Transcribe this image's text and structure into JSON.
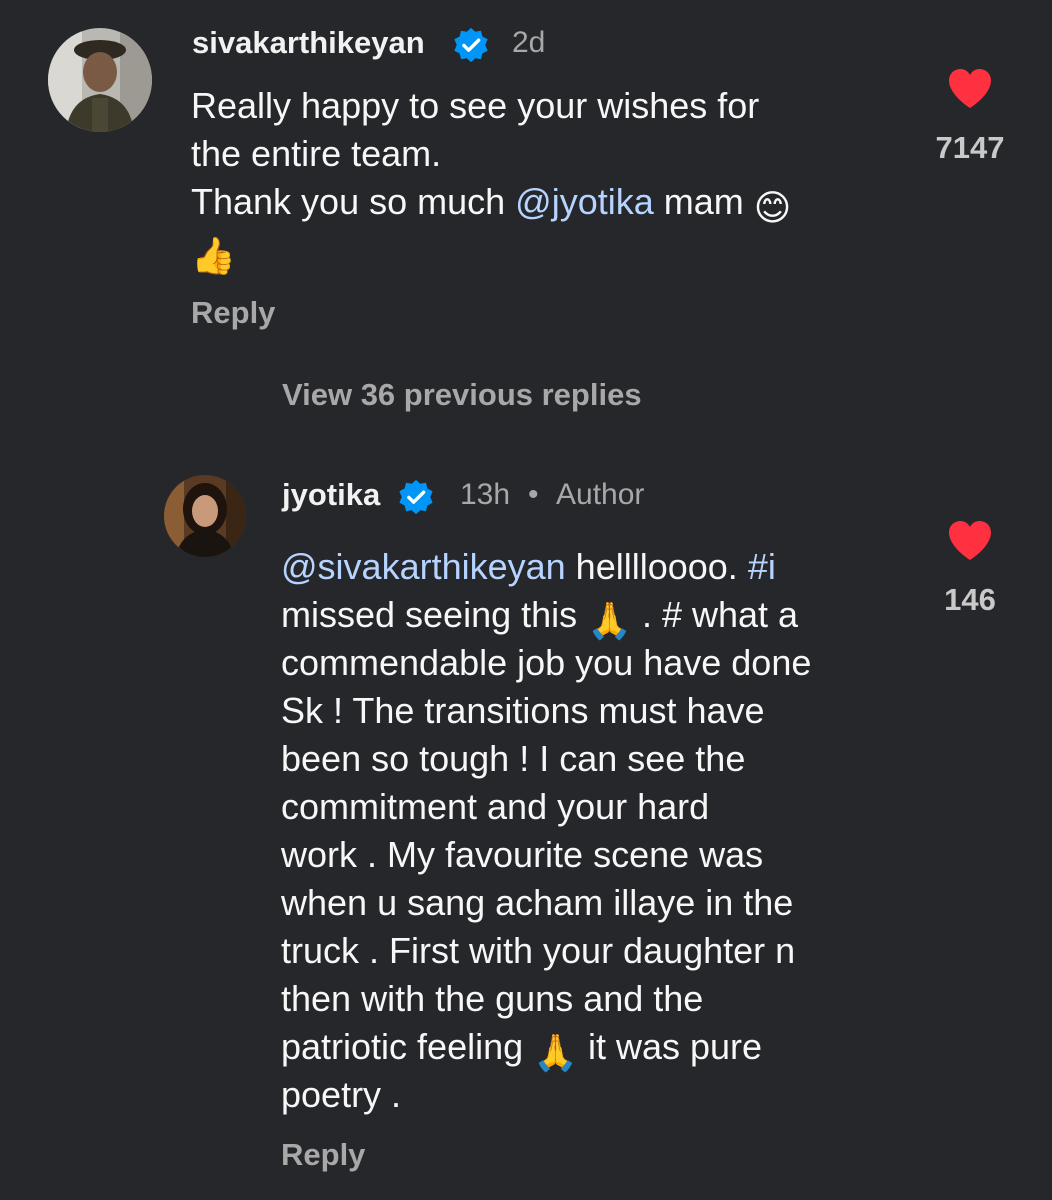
{
  "comments": [
    {
      "username": "sivakarthikeyan",
      "verified": true,
      "time": "2d",
      "lines": [
        {
          "parts": [
            "Really happy to see your wishes for"
          ]
        },
        {
          "parts": [
            "the entire team."
          ]
        },
        {
          "parts": [
            "Thank you so much ",
            "@jyotika",
            " mam "
          ]
        }
      ],
      "emoji_line_1": "😊",
      "emoji_line_2": "👍",
      "reply_label": "Reply",
      "likes": "7147"
    },
    {
      "username": "jyotika",
      "verified": true,
      "time": "13h",
      "dot": "•",
      "author_badge": "Author",
      "lines": [
        {
          "parts": [
            "@sivakarthikeyan",
            " helllloooo. ",
            "#i"
          ]
        },
        {
          "parts": [
            "missed seeing this ",
            " . # what a"
          ]
        },
        {
          "parts": [
            "commendable job you have done"
          ]
        },
        {
          "parts": [
            "Sk ! The transitions must have"
          ]
        },
        {
          "parts": [
            "been so tough ! I can see the"
          ]
        },
        {
          "parts": [
            "commitment and your hard"
          ]
        },
        {
          "parts": [
            "work . My favourite scene was"
          ]
        },
        {
          "parts": [
            "when u sang  acham illaye in the"
          ]
        },
        {
          "parts": [
            "truck . First with your daughter n"
          ]
        },
        {
          "parts": [
            "then with the guns and the"
          ]
        },
        {
          "parts": [
            "patriotic feeling ",
            " it was pure"
          ]
        },
        {
          "parts": [
            "poetry ."
          ]
        }
      ],
      "emoji_pray": "🙏",
      "reply_label": "Reply",
      "likes": "146"
    }
  ],
  "view_previous_replies": "View 36 previous replies",
  "colors": {
    "background": "#26272b",
    "mention": "#b6d4ff",
    "heart": "#ff3040",
    "verified": "#0095f6",
    "muted": "#a8a8a8"
  },
  "icons": [
    "verified-badge-icon",
    "heart-icon"
  ]
}
